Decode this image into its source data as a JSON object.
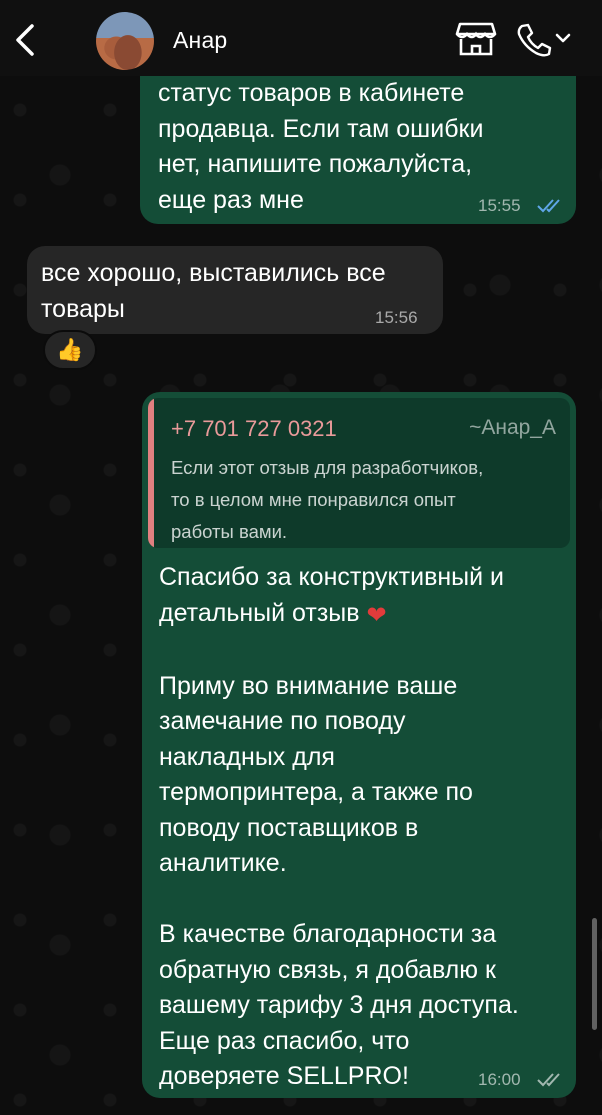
{
  "header": {
    "back_icon": "chevron-left-icon",
    "contact_name": "Анар",
    "store_icon": "store-icon",
    "call_icon": "phone-icon"
  },
  "messages": [
    {
      "direction": "outgoing",
      "text": "статус товаров в кабинете\nпродавца. Если там ошибки\nнет, напишите пожалуйста,\nеще раз мне",
      "time": "15:55",
      "status": "read"
    },
    {
      "direction": "incoming",
      "text": "все хорошо, выставились все\nтовары",
      "time": "15:56",
      "reaction": "👍"
    },
    {
      "direction": "outgoing",
      "quote": {
        "phone": "+7 701 727 0321",
        "author": "~Анар_А",
        "text": "Если этот отзыв для разработчиков,\nто в целом мне понравился опыт\nработы вами."
      },
      "text_part1": "Спасибо за конструктивный и\nдетальный отзыв ",
      "heart": "❤",
      "text_part2": "\n\nПриму во внимание ваше\nзамечание по поводу\nнакладных для\nтермопринтера, а также по\nповоду поставщиков в\nаналитике.\n\nВ качестве благодарности за\nобратную связь, я добавлю к\nвашему тарифу 3 дня доступа.\nЕще раз спасибо, что\nдоверяете SELLPRO!",
      "time": "16:00",
      "status": "delivered"
    }
  ],
  "colors": {
    "outgoing_bubble": "#144d37",
    "incoming_bubble": "#262626",
    "read_ticks": "#5fa6e8",
    "quote_accent": "#e08080"
  }
}
